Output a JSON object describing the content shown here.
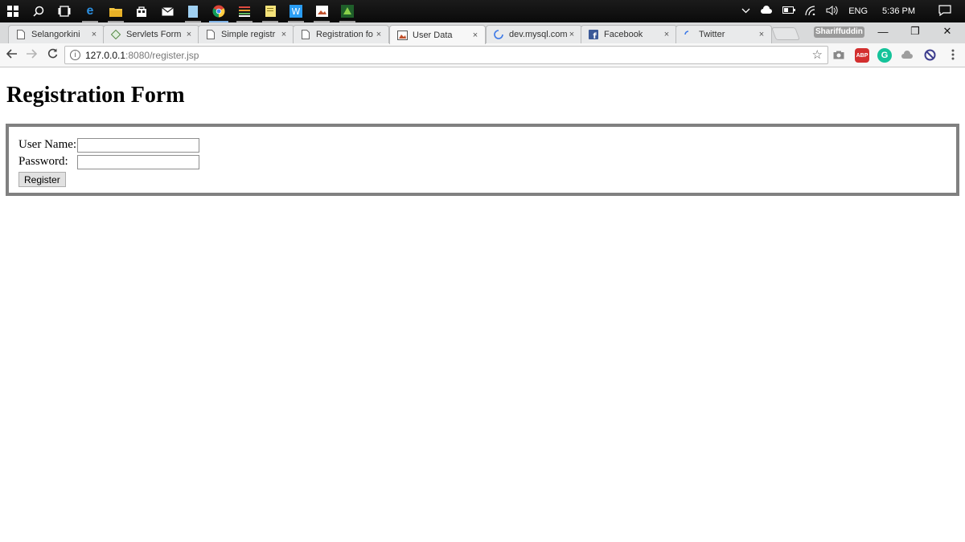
{
  "taskbar": {
    "tray": {
      "chevron": "^",
      "language": "ENG",
      "time": "5:36 PM"
    }
  },
  "tabs": [
    {
      "title": "Selangorkini",
      "close": "×"
    },
    {
      "title": "Servlets Form",
      "close": "×"
    },
    {
      "title": "Simple registr",
      "close": "×"
    },
    {
      "title": "Registration fo",
      "close": "×"
    },
    {
      "title": "User Data",
      "close": "×"
    },
    {
      "title": "dev.mysql.com",
      "close": "×"
    },
    {
      "title": "Facebook",
      "close": "×"
    },
    {
      "title": "Twitter",
      "close": "×"
    }
  ],
  "profile_name": "Shariffuddin",
  "window_controls": {
    "minimize": "—",
    "restore": "❐",
    "close": "✕"
  },
  "omnibox": {
    "url_host": "127.0.0.1",
    "url_rest": ":8080/register.jsp"
  },
  "extensions": {
    "abp": "ABP",
    "grammarly": "G"
  },
  "page": {
    "heading": "Registration Form",
    "username_label": "User Name:",
    "password_label": "Password:",
    "username_value": "",
    "password_value": "",
    "register_button": "Register"
  }
}
